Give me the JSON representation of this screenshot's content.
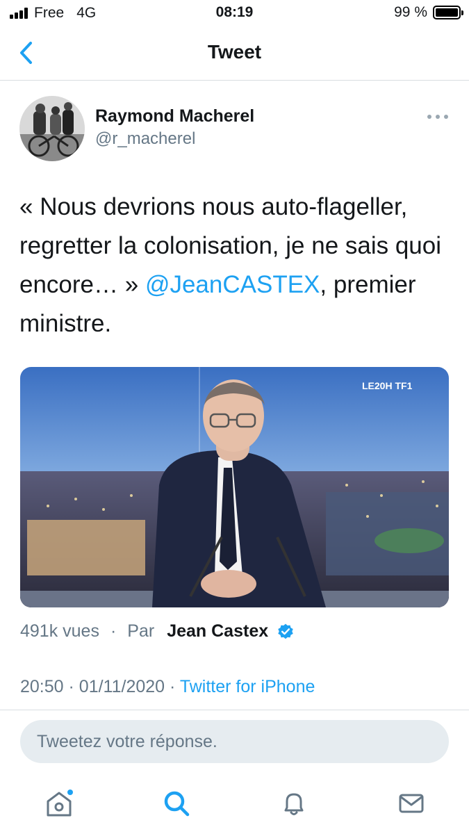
{
  "status_bar": {
    "carrier": "Free",
    "network": "4G",
    "time": "08:19",
    "battery": "99 %",
    "battery_level": 0.99
  },
  "nav": {
    "title": "Tweet",
    "back_icon": "chevron-left-icon"
  },
  "tweet": {
    "author_name": "Raymond Macherel",
    "author_handle": "@r_macherel",
    "text_before_mention": "« Nous devrions nous auto-flageller, regretter la colonisation, je ne sais quoi encore… » ",
    "mention": "@JeanCASTEX",
    "text_after_mention": ", premier ministre.",
    "media_logo": "LE20H TF1",
    "views": "491k vues",
    "separator": "·",
    "by_label": "Par",
    "by_name": "Jean Castex",
    "time": "20:50",
    "date": "01/11/2020",
    "source": "Twitter for iPhone"
  },
  "reply": {
    "placeholder": "Tweetez votre réponse."
  },
  "colors": {
    "accent": "#1da1f2",
    "secondary_text": "#657786",
    "divider": "#d8dde1"
  },
  "tab_bar": {
    "items": [
      "home-icon",
      "search-icon",
      "bell-icon",
      "mail-icon"
    ],
    "active": "search-icon"
  }
}
